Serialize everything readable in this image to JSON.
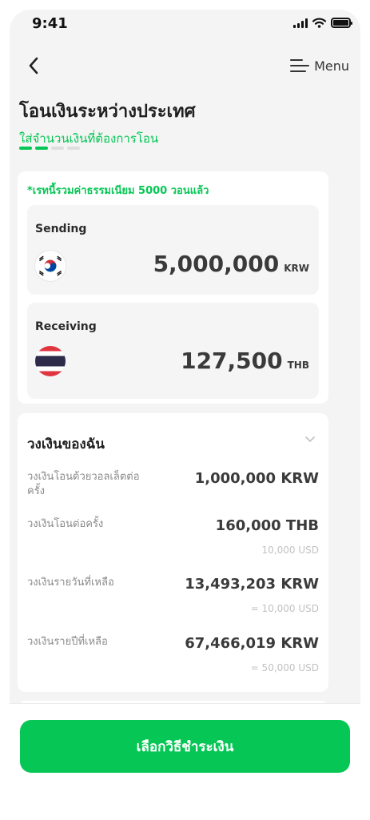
{
  "status_bar": {
    "time": "9:41"
  },
  "nav": {
    "menu_label": "Menu"
  },
  "header": {
    "title": "โอนเงินระหว่างประเทศ",
    "step_text": "ใส่จำนวนเงินที่ต้องการโอน",
    "step_current": 2,
    "step_total": 4
  },
  "exchange": {
    "fee_note": "*เรทนี้รวมค่าธรรมเนียม 5000 วอนแล้ว",
    "sending": {
      "label": "Sending",
      "amount": "5,000,000",
      "currency": "KRW",
      "flag_icon": "south-korea-flag-icon"
    },
    "receiving": {
      "label": "Receiving",
      "amount": "127,500",
      "currency": "THB",
      "flag_icon": "thailand-flag-icon"
    }
  },
  "limits": {
    "title": "วงเงินของฉัน",
    "rows": [
      {
        "label": "วงเงินโอนด้วยวอลเล็ตต่อครั้ง",
        "value": "1,000,000 KRW",
        "sub": ""
      },
      {
        "label": "วงเงินโอนต่อครั้ง",
        "value": "160,000 THB",
        "sub": "10,000 USD"
      },
      {
        "label": "วงเงินรายวันที่เหลือ",
        "value": "13,493,203 KRW",
        "sub": "= 10,000 USD"
      },
      {
        "label": "วงเงินรายปีที่เหลือ",
        "value": "67,466,019 KRW",
        "sub": "= 50,000 USD"
      }
    ]
  },
  "cta": {
    "label": "เลือกวิธีชำระเงิน"
  },
  "colors": {
    "accent": "#06c755",
    "background": "#f4f4f4",
    "card": "#ffffff"
  }
}
